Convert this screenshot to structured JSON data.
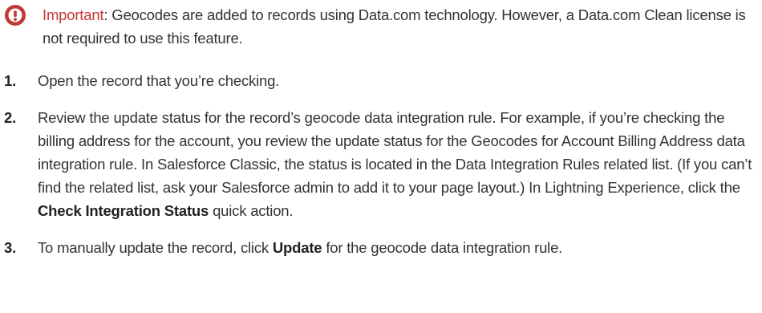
{
  "important": {
    "label": "Important",
    "colon": ":",
    "text": " Geocodes are added to records using Data.com technology. However, a Data.com Clean license is not required to use this feature.",
    "icon": "exclamation-circle-icon",
    "accent_color": "#c23934"
  },
  "steps": [
    {
      "number": "1.",
      "text_before": "Open the record that you’re checking."
    },
    {
      "number": "2.",
      "text_before": "Review the update status for the record’s geocode data integration rule. For example, if you’re checking the billing address for the account, you review the update status for the Geocodes for Account Billing Address data integration rule. In Salesforce Classic, the status is located in the Data Integration Rules related list. (If you can’t find the related list, ask your Salesforce admin to add it to your page layout.) In Lightning Experience, click the ",
      "bold": "Check Integration Status",
      "text_after": " quick action."
    },
    {
      "number": "3.",
      "text_before": "To manually update the record, click ",
      "bold": "Update",
      "text_after": " for the geocode data integration rule."
    }
  ]
}
